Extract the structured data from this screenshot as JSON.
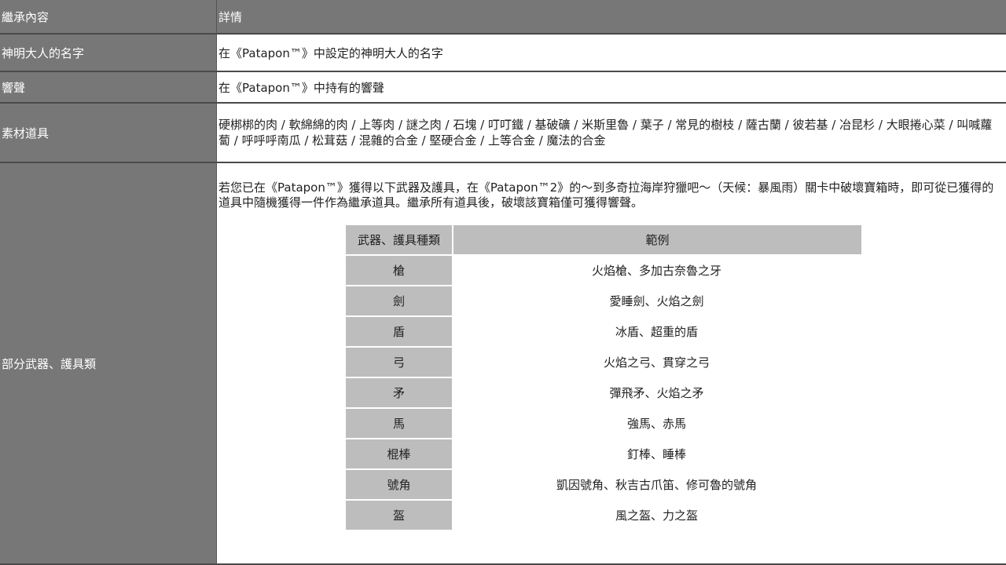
{
  "header": {
    "col1": "繼承內容",
    "col2": "詳情"
  },
  "rows": [
    {
      "label": "神明大人的名字",
      "value": "在《Patapon™》中設定的神明大人的名字"
    },
    {
      "label": "響聲",
      "value": "在《Patapon™》中持有的響聲"
    },
    {
      "label": "素材道具",
      "value": "硬梆梆的肉 / 軟綿綿的肉 / 上等肉 / 謎之肉 / 石塊 / 叮叮鐵 / 基破礦 / 米斯里魯 / 葉子 / 常見的樹枝 / 薩古蘭 / 彼若基 / 冶昆杉 / 大眼捲心菜 / 叫喊蘿蔔 / 呼呼呼南瓜 / 松茸菇 / 混雜的合金 / 堅硬合金 / 上等合金 / 魔法的合金"
    },
    {
      "label": "部分武器、護具類",
      "intro": "若您已在《Patapon™》獲得以下武器及護具，在《Patapon™2》的～到多奇拉海岸狩獵吧～（天候：暴風雨）關卡中破壞寶箱時，即可從已獲得的道具中隨機獲得一件作為繼承道具。繼承所有道具後，破壞該寶箱僅可獲得響聲。"
    }
  ],
  "weapons": {
    "header": {
      "type": "武器、護具種類",
      "example": "範例"
    },
    "items": [
      {
        "type": "槍",
        "example": "火焰槍、多加古奈魯之牙"
      },
      {
        "type": "劍",
        "example": "愛睡劍、火焰之劍"
      },
      {
        "type": "盾",
        "example": "冰盾、超重的盾"
      },
      {
        "type": "弓",
        "example": "火焰之弓、貫穿之弓"
      },
      {
        "type": "矛",
        "example": "彈飛矛、火焰之矛"
      },
      {
        "type": "馬",
        "example": "強馬、赤馬"
      },
      {
        "type": "棍棒",
        "example": "釘棒、睡棒"
      },
      {
        "type": "號角",
        "example": "凱因號角、秋吉古爪笛、修可魯的號角"
      },
      {
        "type": "盔",
        "example": "風之盔、力之盔"
      }
    ]
  }
}
